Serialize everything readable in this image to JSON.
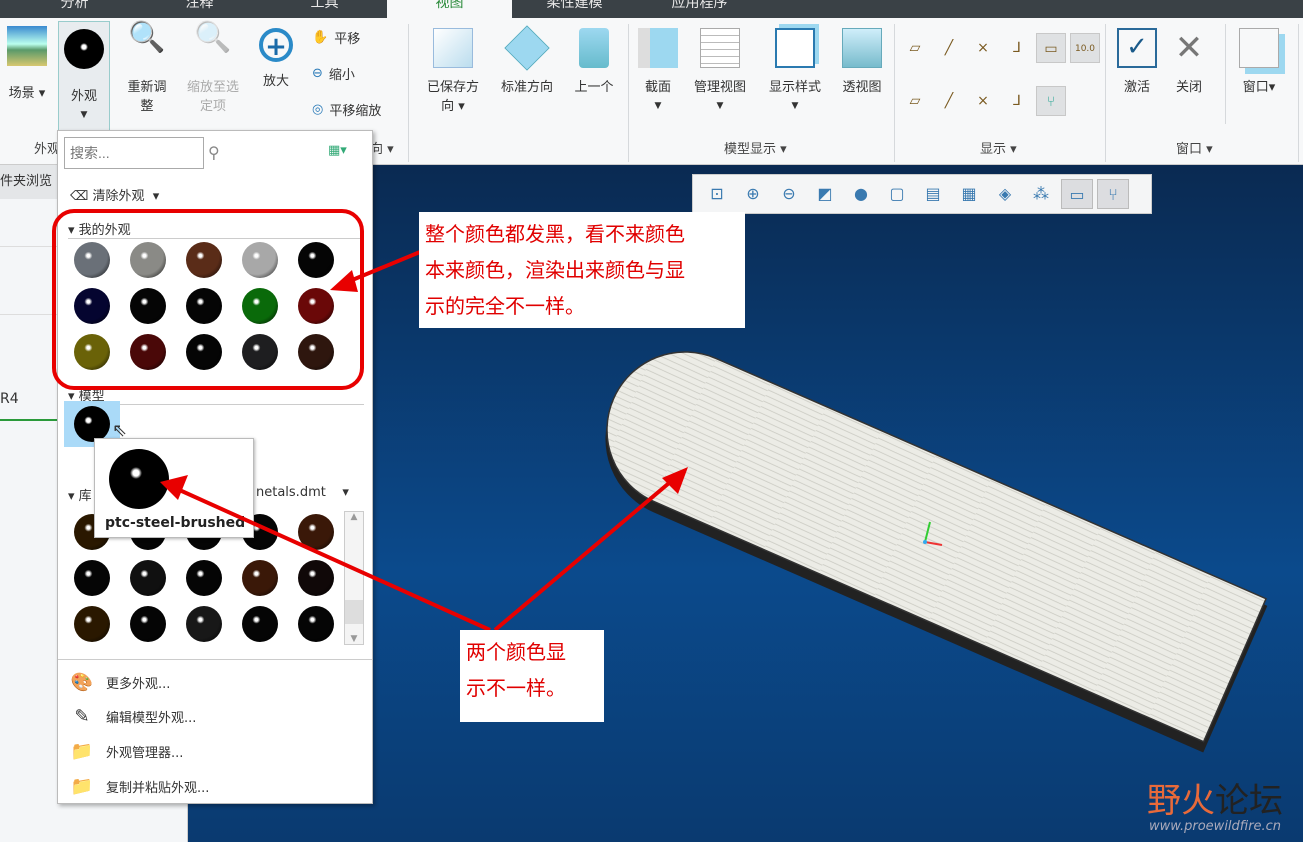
{
  "tabs": [
    "分析",
    "注释",
    "工具",
    "视图",
    "柔性建模",
    "应用程序"
  ],
  "ribbon": {
    "scene": "场景",
    "appearance": "外观",
    "refit": [
      "重新调",
      "整"
    ],
    "zoom_selected": [
      "缩放至选",
      "定项"
    ],
    "zoom_in": "放大",
    "pan": "平移",
    "zoom_out": "缩小",
    "pan_zoom": "平移缩放",
    "saved_orient": [
      "已保存方",
      "向"
    ],
    "std_orient": "标准方向",
    "previous": "上一个",
    "section": "截面",
    "manage_views": "管理视图",
    "display_style": "显示样式",
    "perspective": "透视图",
    "activate": "激活",
    "close": "关闭",
    "window": "窗口",
    "groups": {
      "appearance": "外观",
      "orient": "向",
      "model_display": "模型显示",
      "show": "显示",
      "window": "窗口"
    },
    "show_value": "10.0"
  },
  "left_panel": {
    "tab": "件夹浏览",
    "item": "R4"
  },
  "dropdown": {
    "search_placeholder": "搜索...",
    "clear": "清除外观",
    "my_appearances": "我的外观",
    "model": "模型",
    "library": "库",
    "library_file": "netals.dmt",
    "tooltip": "ptc-steel-brushed",
    "menu": [
      "更多外观...",
      "编辑模型外观...",
      "外观管理器...",
      "复制并粘贴外观..."
    ],
    "my_colors": [
      "#6a7078",
      "#8a8a86",
      "#5a2c18",
      "#a8a8a8",
      "#050505",
      "#050530",
      "#050505",
      "#050505",
      "#0a6a0a",
      "#6a0808",
      "#6a6208",
      "#4a0808",
      "#050505",
      "#1e1e20",
      "#2e160e"
    ],
    "lib_colors": [
      "#2a1800",
      "#050505",
      "#050505",
      "#050505",
      "#3a1808",
      "#050505",
      "#101010",
      "#050505",
      "#3a1808",
      "#100808",
      "#2a1800",
      "#050505",
      "#181818",
      "#050505",
      "#050505"
    ]
  },
  "callouts": {
    "top": [
      "整个颜色都发黑，看不来颜色",
      "本来颜色，渲染出来颜色与显",
      "示的完全不一样。"
    ],
    "bottom": [
      "两个颜色显",
      "示不一样。"
    ]
  },
  "watermark": {
    "name": "野火论坛",
    "url": "www.proewildfire.cn"
  }
}
